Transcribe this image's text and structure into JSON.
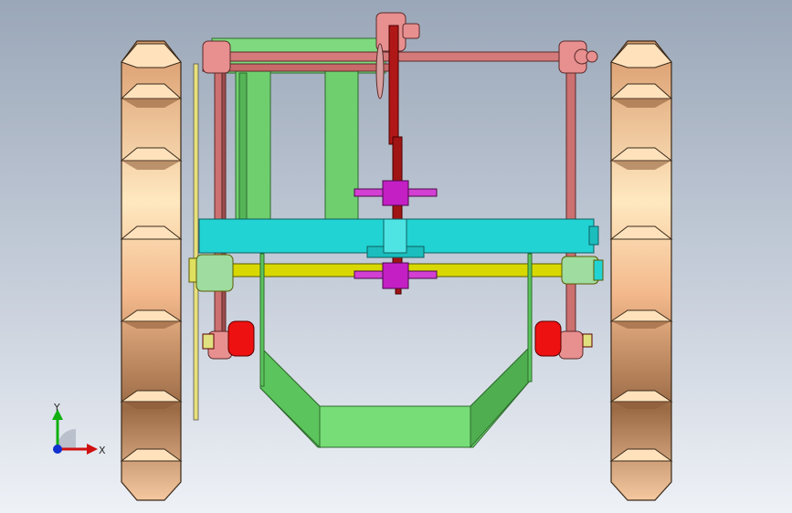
{
  "viewport": {
    "background_top": "#9aa7b8",
    "background_bottom": "#eef1f6"
  },
  "model": {
    "parts": [
      {
        "name": "left-track-wheel",
        "color": "#f0b889"
      },
      {
        "name": "right-track-wheel",
        "color": "#f0b889"
      },
      {
        "name": "frame-side-plate",
        "color": "#77dd77"
      },
      {
        "name": "lower-scoop",
        "color": "#77dd77"
      },
      {
        "name": "cross-beam",
        "color": "#22d3d3"
      },
      {
        "name": "axle",
        "color": "#d4d400"
      },
      {
        "name": "linkage-rods",
        "color": "#cc6666"
      },
      {
        "name": "vertical-shaft",
        "color": "#aa1111"
      },
      {
        "name": "hub-blocks",
        "color": "#c41fc4"
      },
      {
        "name": "springs",
        "color": "#ee1111"
      }
    ]
  },
  "triad": {
    "x_label": "X",
    "y_label": "Y",
    "x_color": "#d01010",
    "y_color": "#10b010",
    "z_color": "#1030d0"
  }
}
